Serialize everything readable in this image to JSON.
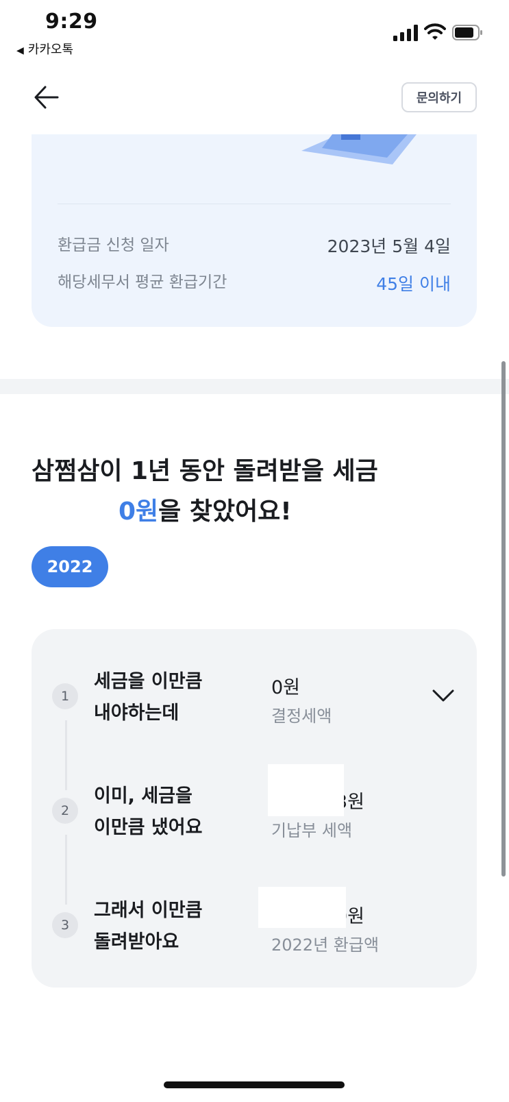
{
  "status_bar": {
    "time": "9:29",
    "back_app": "카카오톡"
  },
  "header": {
    "inquire_label": "문의하기"
  },
  "info": {
    "rows": [
      {
        "label": "환급금 신청 일자",
        "value": "2023년 5월 4일"
      },
      {
        "label": "해당세무서 평균 환급기간",
        "value": "45일 이내"
      }
    ]
  },
  "headline": {
    "line1": "삼쩜삼이 1년 동안 돌려받을 세금",
    "amount": "0원",
    "line2_suffix": "을 찾았어요!"
  },
  "year": "2022",
  "steps": [
    {
      "number": "1",
      "label_line1": "세금을 이만큼",
      "label_line2": "내야하는데",
      "amount": "0원",
      "desc": "결정세액"
    },
    {
      "number": "2",
      "label_line1": "이미, 세금을",
      "label_line2": "이만큼 냈어요",
      "amount": "3원",
      "desc": "기납부 세액"
    },
    {
      "number": "3",
      "label_line1": "그래서 이만큼",
      "label_line2": "돌려받아요",
      "amount": "0원",
      "desc": "2022년 환급액"
    }
  ],
  "colors": {
    "accent": "#3f7fe6",
    "card_bg": "#eef4fd",
    "summary_bg": "#f2f4f6"
  },
  "icons": [
    "back-app-arrow-icon",
    "signal-icon",
    "wifi-icon",
    "battery-icon",
    "back-arrow-icon",
    "chevron-down-icon"
  ]
}
